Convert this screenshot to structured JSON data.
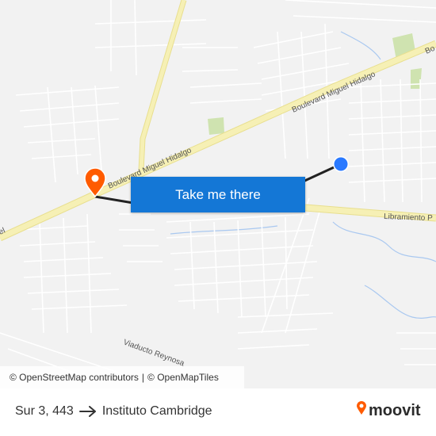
{
  "map": {
    "road_labels": {
      "boulevard_upper": "Boulevard Miguel Hidalgo",
      "boulevard_lower": "Boulevard Miguel Hidalgo",
      "boulevard_edge_left": "el",
      "boulevard_edge_right": "Bo",
      "libramiento": "Libramiento P",
      "viaducto": "Viaducto Reynosa"
    },
    "colors": {
      "background": "#f2f2f2",
      "streets": "#ffffff",
      "highway": "#f6f0b5",
      "highway_border": "#e8df8f",
      "route_line": "#222222",
      "origin_dot": "#2979ff",
      "destination_pin": "#ff5b00",
      "water": "#a9c8f0",
      "park": "#cfe3b0"
    },
    "origin_icon": "origin-dot-icon",
    "destination_icon": "destination-pin-icon"
  },
  "cta": {
    "label": "Take me there"
  },
  "attribution": {
    "osm": "© OpenStreetMap contributors",
    "separator": "|",
    "omt": "© OpenMapTiles"
  },
  "footer": {
    "origin": "Sur 3, 443",
    "arrow_icon": "arrow-right-icon",
    "destination": "Instituto Cambridge",
    "brand": "moovit",
    "brand_icon": "moovit-pin-icon"
  }
}
